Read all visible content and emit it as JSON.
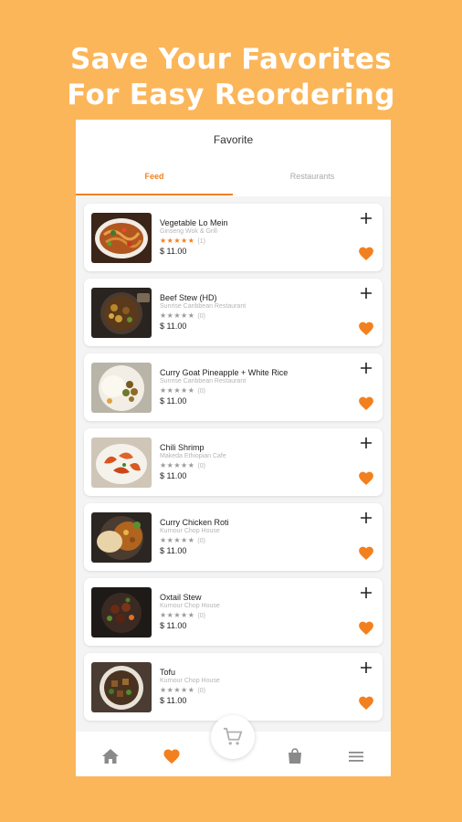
{
  "headline": {
    "line1": "Save Your Favorites",
    "line2": "For Easy Reordering"
  },
  "appbar": {
    "title": "Favorite"
  },
  "tabs": [
    {
      "label": "Feed",
      "active": true
    },
    {
      "label": "Restaurants",
      "active": false
    }
  ],
  "colors": {
    "background": "#FBB65A",
    "accent": "#F3801F"
  },
  "favorites": [
    {
      "name": "Vegetable Lo Mein",
      "restaurant": "Ginseng Wok & Grill",
      "stars": "★★★★★",
      "rating": 5,
      "count": "(1)",
      "price": "$ 11.00",
      "image": "noodles-photo"
    },
    {
      "name": "Beef Stew (HD)",
      "restaurant": "Sunrise Caribbean Restaurant",
      "stars": "★★★★★",
      "rating": 0,
      "count": "(0)",
      "price": "$ 11.00",
      "image": "beef-stew-photo"
    },
    {
      "name": "Curry Goat Pineapple + White Rice",
      "restaurant": "Sunrise Caribbean Restaurant",
      "stars": "★★★★★",
      "rating": 0,
      "count": "(0)",
      "price": "$ 11.00",
      "image": "curry-goat-photo"
    },
    {
      "name": "Chili Shrimp",
      "restaurant": "Makeda Ethiopian Cafe",
      "stars": "★★★★★",
      "rating": 0,
      "count": "(0)",
      "price": "$ 11.00",
      "image": "chili-shrimp-photo"
    },
    {
      "name": "Curry Chicken Roti",
      "restaurant": "Kurnour Chop House",
      "stars": "★★★★★",
      "rating": 0,
      "count": "(0)",
      "price": "$ 11.00",
      "image": "chicken-roti-photo"
    },
    {
      "name": "Oxtail Stew",
      "restaurant": "Kurnour Chop House",
      "stars": "★★★★★",
      "rating": 0,
      "count": "(0)",
      "price": "$ 11.00",
      "image": "oxtail-stew-photo"
    },
    {
      "name": "Tofu",
      "restaurant": "Kurnour Chop House",
      "stars": "★★★★★",
      "rating": 0,
      "count": "(0)",
      "price": "$ 11.00",
      "image": "tofu-photo"
    }
  ],
  "bottom_nav": {
    "items": [
      "home-icon",
      "heart-icon",
      "bag-icon",
      "menu-icon"
    ],
    "active": "heart-icon",
    "center": "cart-icon"
  }
}
